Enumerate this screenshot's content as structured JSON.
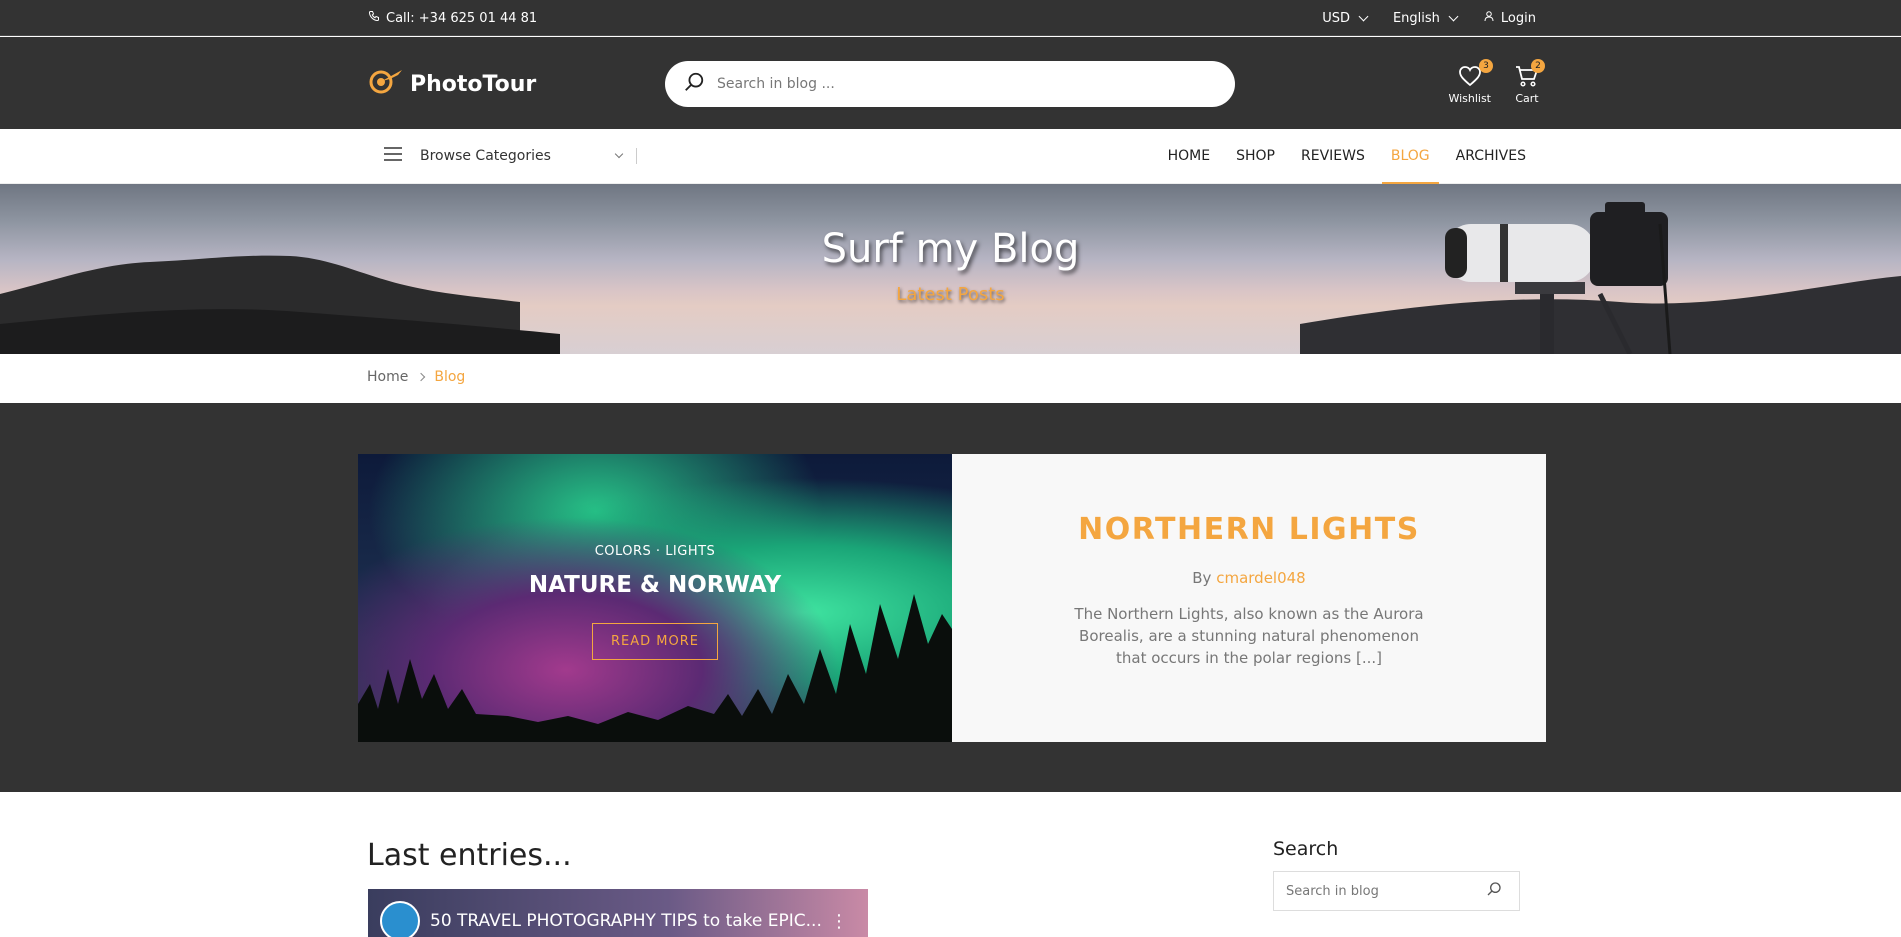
{
  "topbar": {
    "call": "Call: +34 625 01 44 81",
    "currency": "USD",
    "language": "English",
    "login": "Login"
  },
  "header": {
    "logo_text": "PhotoTour",
    "search_placeholder": "Search in blog ...",
    "wishlist_label": "Wishlist",
    "wishlist_count": "3",
    "cart_label": "Cart",
    "cart_count": "2"
  },
  "nav": {
    "browse_label": "Browse Categories",
    "items": [
      {
        "label": "HOME"
      },
      {
        "label": "SHOP"
      },
      {
        "label": "REVIEWS"
      },
      {
        "label": "BLOG"
      },
      {
        "label": "ARCHIVES"
      }
    ]
  },
  "banner": {
    "title": "Surf my Blog",
    "subtitle": "Latest Posts"
  },
  "breadcrumb": {
    "home": "Home",
    "current": "Blog"
  },
  "featured": {
    "categories": "COLORS · LIGHTS",
    "image_heading": "NATURE & NORWAY",
    "read_more": "READ MORE",
    "title": "NORTHERN LIGHTS",
    "by_prefix": "By",
    "author": "cmardel048",
    "excerpt": "The Northern Lights, also known as the Aurora Borealis, are a stunning natural phenomenon that occurs in the polar regions [...]"
  },
  "main": {
    "last_entries": "Last entries...",
    "video_title": "50 TRAVEL PHOTOGRAPHY TIPS to take EPIC..."
  },
  "sidebar": {
    "search_title": "Search",
    "search_placeholder": "Search in blog"
  },
  "colors": {
    "accent": "#f4a640",
    "dark": "#333333"
  }
}
